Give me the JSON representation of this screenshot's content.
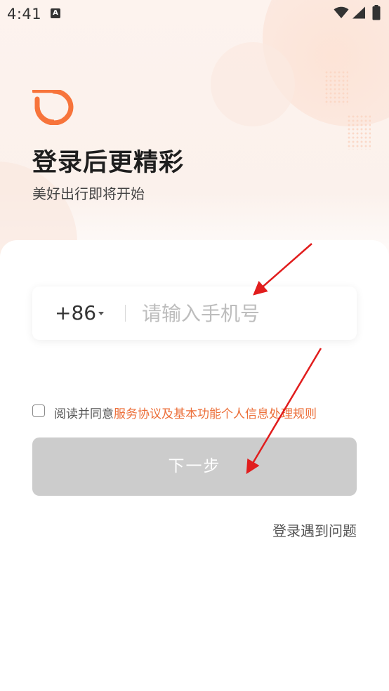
{
  "status_bar": {
    "time": "4:41",
    "notification_icon_letter": "A"
  },
  "header": {
    "logo": "didi-logo",
    "title": "登录后更精彩",
    "subtitle": "美好出行即将开始"
  },
  "form": {
    "country_code": "+86",
    "phone_placeholder": "请输入手机号",
    "agreement_prefix": "阅读并同意",
    "agreement_link": "服务协议及基本功能个人信息处理规则",
    "next_label": "下一步",
    "login_help": "登录遇到问题"
  },
  "colors": {
    "brand": "#f7743b",
    "link": "#ec6e38",
    "button_disabled": "#cccccc",
    "annotation": "#e11d1d"
  },
  "icons": [
    "wifi-icon",
    "signal-icon",
    "battery-icon",
    "caret-down-icon",
    "checkbox-icon"
  ]
}
